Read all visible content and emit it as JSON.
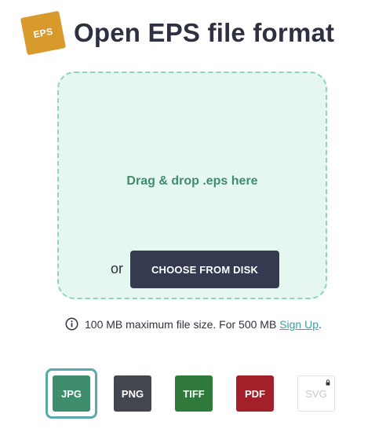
{
  "header": {
    "badge": "EPS",
    "title": "Open EPS file format"
  },
  "dropzone": {
    "drop_text": "Drag & drop .eps here",
    "or_text": "or",
    "choose_label": "CHOOSE FROM DISK"
  },
  "info": {
    "text": "100 MB maximum file size. For 500 MB",
    "link": "Sign Up",
    "end": "."
  },
  "formats": [
    {
      "label": "JPG",
      "color": "#3e8e6d",
      "selected": true
    },
    {
      "label": "PNG",
      "color": "#43454f",
      "selected": false
    },
    {
      "label": "TIFF",
      "color": "#2f7a3b",
      "selected": false
    },
    {
      "label": "PDF",
      "color": "#a3202a",
      "selected": false
    },
    {
      "label": "SVG",
      "color": "#ffffff",
      "locked": true
    }
  ],
  "icons": {
    "info": "info-circle-icon",
    "lock": "lock-icon"
  }
}
